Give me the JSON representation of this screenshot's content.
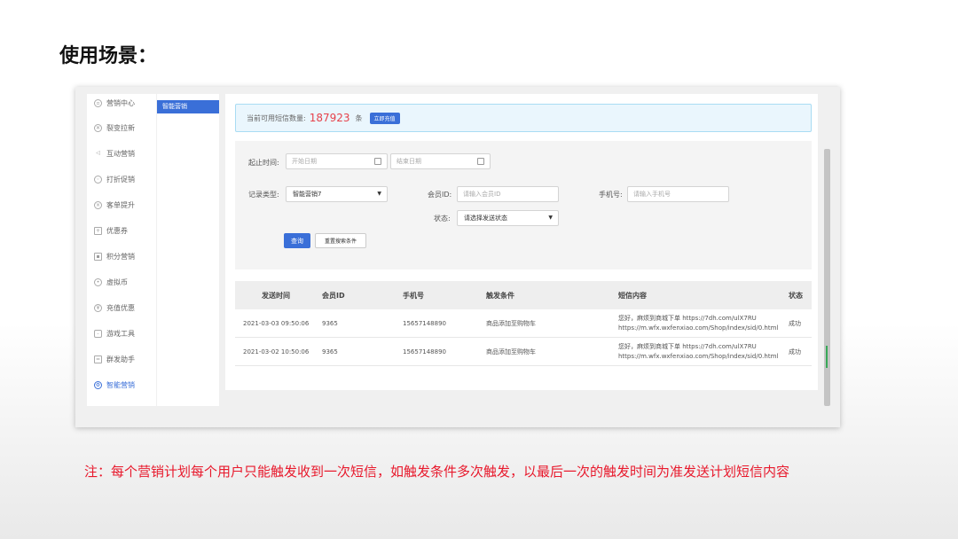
{
  "slide": {
    "title": "使用场景：",
    "note": "注：每个营销计划每个用户只能触发收到一次短信，如触发条件多次触发，以最后一次的触发时间为准发送计划短信内容"
  },
  "sidebar": {
    "items": [
      {
        "label": "营销中心",
        "icon": "grid-icon"
      },
      {
        "label": "裂变拉新",
        "icon": "fission-icon"
      },
      {
        "label": "互动营销",
        "icon": "send-icon"
      },
      {
        "label": "打折促销",
        "icon": "discount-icon"
      },
      {
        "label": "客单提升",
        "icon": "close-circle-icon"
      },
      {
        "label": "优惠券",
        "icon": "coupon-icon"
      },
      {
        "label": "积分营销",
        "icon": "points-icon"
      },
      {
        "label": "虚拟币",
        "icon": "coin-icon"
      },
      {
        "label": "充值优惠",
        "icon": "recharge-icon"
      },
      {
        "label": "游戏工具",
        "icon": "game-icon"
      },
      {
        "label": "群发助手",
        "icon": "broadcast-icon"
      },
      {
        "label": "智能营销",
        "icon": "gear-icon"
      }
    ],
    "active_index": 11
  },
  "subnav": {
    "active_label": "智能营销"
  },
  "notice": {
    "prefix": "当前可用短信数量:",
    "count": "187923",
    "unit": "条",
    "button": "立即充值"
  },
  "filters": {
    "time_label": "起止时间:",
    "start_placeholder": "开始日期",
    "end_placeholder": "结束日期",
    "type_label": "记录类型:",
    "type_value": "智能营销7",
    "member_label": "会员ID:",
    "member_placeholder": "请输入会员ID",
    "phone_label": "手机号:",
    "phone_placeholder": "请输入手机号",
    "status_label": "状态:",
    "status_value": "请选择发送状态",
    "query_button": "查询",
    "reset_button": "重置搜索条件"
  },
  "table": {
    "headers": [
      "发送时间",
      "会员ID",
      "手机号",
      "触发条件",
      "短信内容",
      "状态"
    ],
    "rows": [
      {
        "time": "2021-03-03 09:50:06",
        "member_id": "9365",
        "phone": "15657148890",
        "trigger": "商品添加至购物车",
        "content_line1": "您好，麻烦到商城下单 https://7dh.com/ulX7RU",
        "content_line2": "https://m.wfx.wxfenxiao.com/Shop/index/sid/0.html",
        "status": "成功"
      },
      {
        "time": "2021-03-02 10:50:06",
        "member_id": "9365",
        "phone": "15657148890",
        "trigger": "商品添加至购物车",
        "content_line1": "您好，麻烦到商城下单 https://7dh.com/ulX7RU",
        "content_line2": "https://m.wfx.wxfenxiao.com/Shop/index/sid/0.html",
        "status": "成功"
      }
    ]
  }
}
